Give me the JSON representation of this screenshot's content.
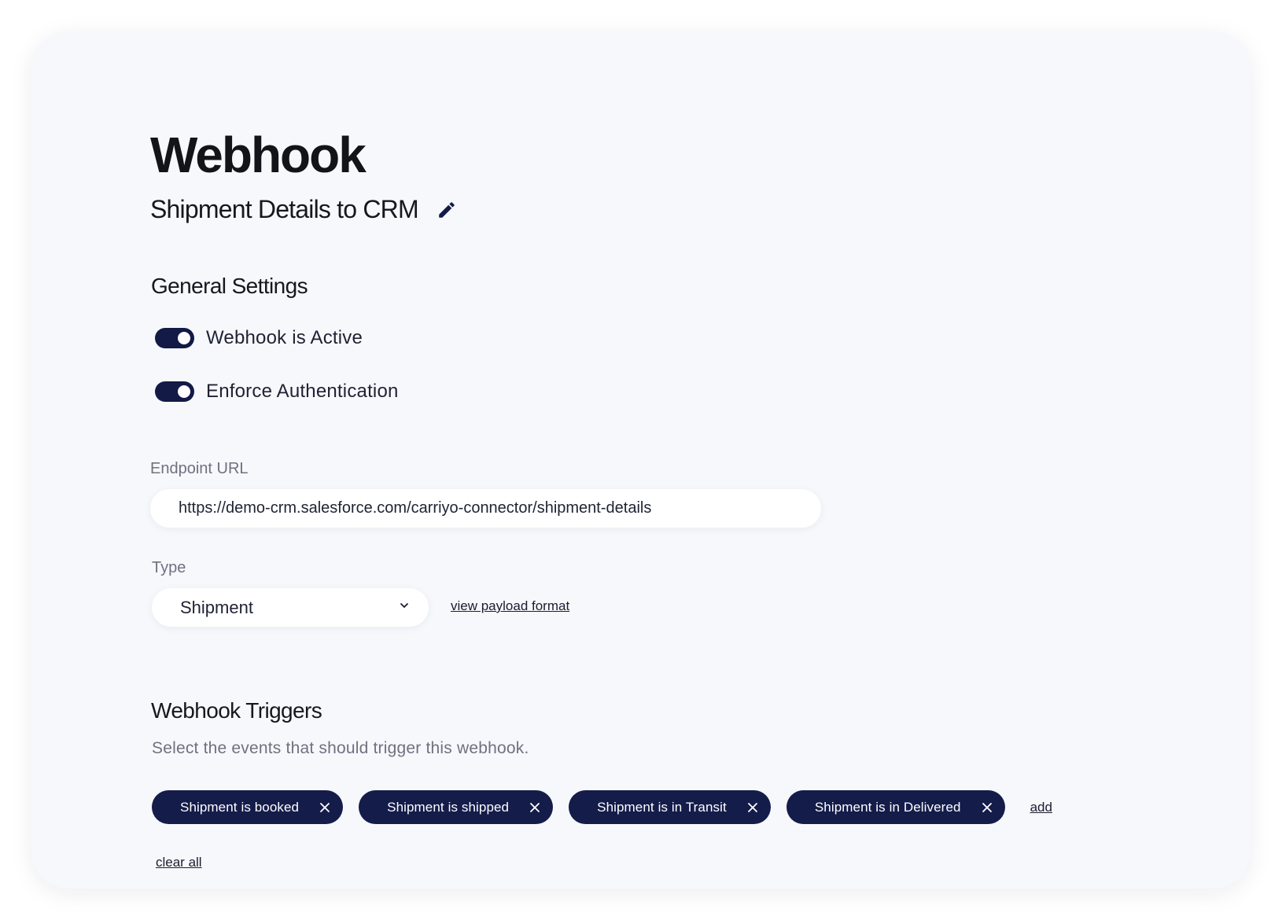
{
  "page": {
    "title": "Webhook",
    "subtitle": "Shipment Details to CRM",
    "edit_icon": "pencil-icon"
  },
  "general_settings": {
    "heading": "General Settings",
    "toggles": [
      {
        "label": "Webhook is Active",
        "on": true
      },
      {
        "label": "Enforce Authentication",
        "on": true
      }
    ]
  },
  "endpoint": {
    "label": "Endpoint URL",
    "value": "https://demo-crm.salesforce.com/carriyo-connector/shipment-details"
  },
  "type": {
    "label": "Type",
    "selected": "Shipment",
    "dropdown_icon": "chevron-down-icon",
    "payload_link": "view payload format"
  },
  "triggers": {
    "heading": "Webhook Triggers",
    "hint": "Select the events that should trigger this webhook.",
    "chips": [
      {
        "label": "Shipment is booked"
      },
      {
        "label": "Shipment is shipped"
      },
      {
        "label": "Shipment is in Transit"
      },
      {
        "label": "Shipment is in Delivered"
      }
    ],
    "add_label": "add",
    "clear_label": "clear all",
    "remove_icon": "close-icon"
  },
  "colors": {
    "accent": "#121a45",
    "chip_bg": "#141c4a",
    "card_bg": "#f6f8fc",
    "muted_text": "#6f7180"
  }
}
